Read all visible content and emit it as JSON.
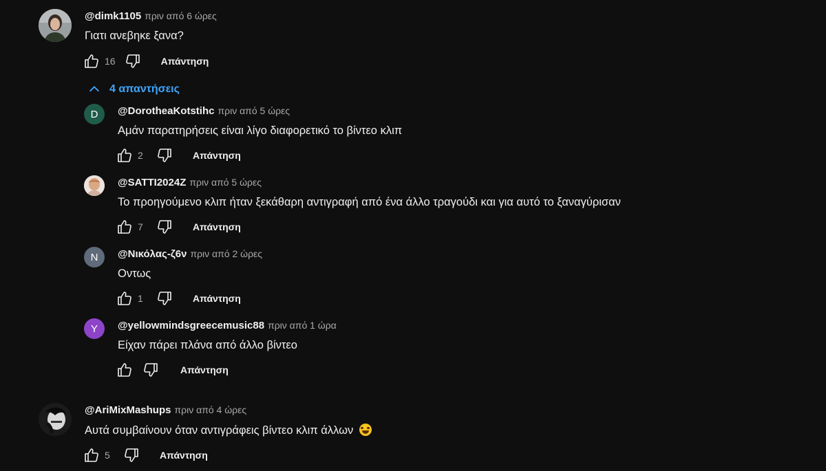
{
  "comments": [
    {
      "author": "@dimk1105",
      "time": "πριν από 6 ώρες",
      "text": "Γιατι ανεβηκε ξανα?",
      "likes": "16",
      "reply_label": "Απάντηση",
      "replies_toggle": "4 απαντήσεις"
    },
    {
      "author": "@AriMixMashups",
      "time": "πριν από 4 ώρες",
      "text": "Αυτά συμβαίνουν όταν αντιγράφεις βίντεο κλιπ άλλων",
      "emoji": "laughing-tears-emoji",
      "likes": "5",
      "reply_label": "Απάντηση"
    }
  ],
  "replies": [
    {
      "author": "@DorotheaKotstihc",
      "time": "πριν από 5 ώρες",
      "text": "Αμάν παρατηρήσεις είναι λίγο διαφορετικό το βίντεο κλιπ",
      "likes": "2",
      "reply_label": "Απάντηση",
      "avatar_letter": "D",
      "avatar_color": "#1f5c4a"
    },
    {
      "author": "@SATTI2024Z",
      "time": "πριν από 5 ώρες",
      "text": "Το προηγούμενο κλιπ ήταν ξεκάθαρη αντιγραφή από ένα άλλο τραγούδι και για αυτό το ξαναγύρισαν",
      "likes": "7",
      "reply_label": "Απάντηση"
    },
    {
      "author": "@Νικόλας-ζ6ν",
      "time": "πριν από 2 ώρες",
      "text": "Οντως",
      "likes": "1",
      "reply_label": "Απάντηση",
      "avatar_letter": "N",
      "avatar_color": "#5f6a7a"
    },
    {
      "author": "@yellowmindsgreecemusic88",
      "time": "πριν από 1 ώρα",
      "text": "Είχαν πάρει πλάνα από άλλο βίντεο",
      "reply_label": "Απάντηση",
      "avatar_letter": "Y",
      "avatar_color": "#8e44c9"
    }
  ],
  "colors": {
    "background": "#0f0f0f",
    "text": "#f1f1f1",
    "secondary": "#aaaaaa",
    "link": "#3ea6ff"
  }
}
